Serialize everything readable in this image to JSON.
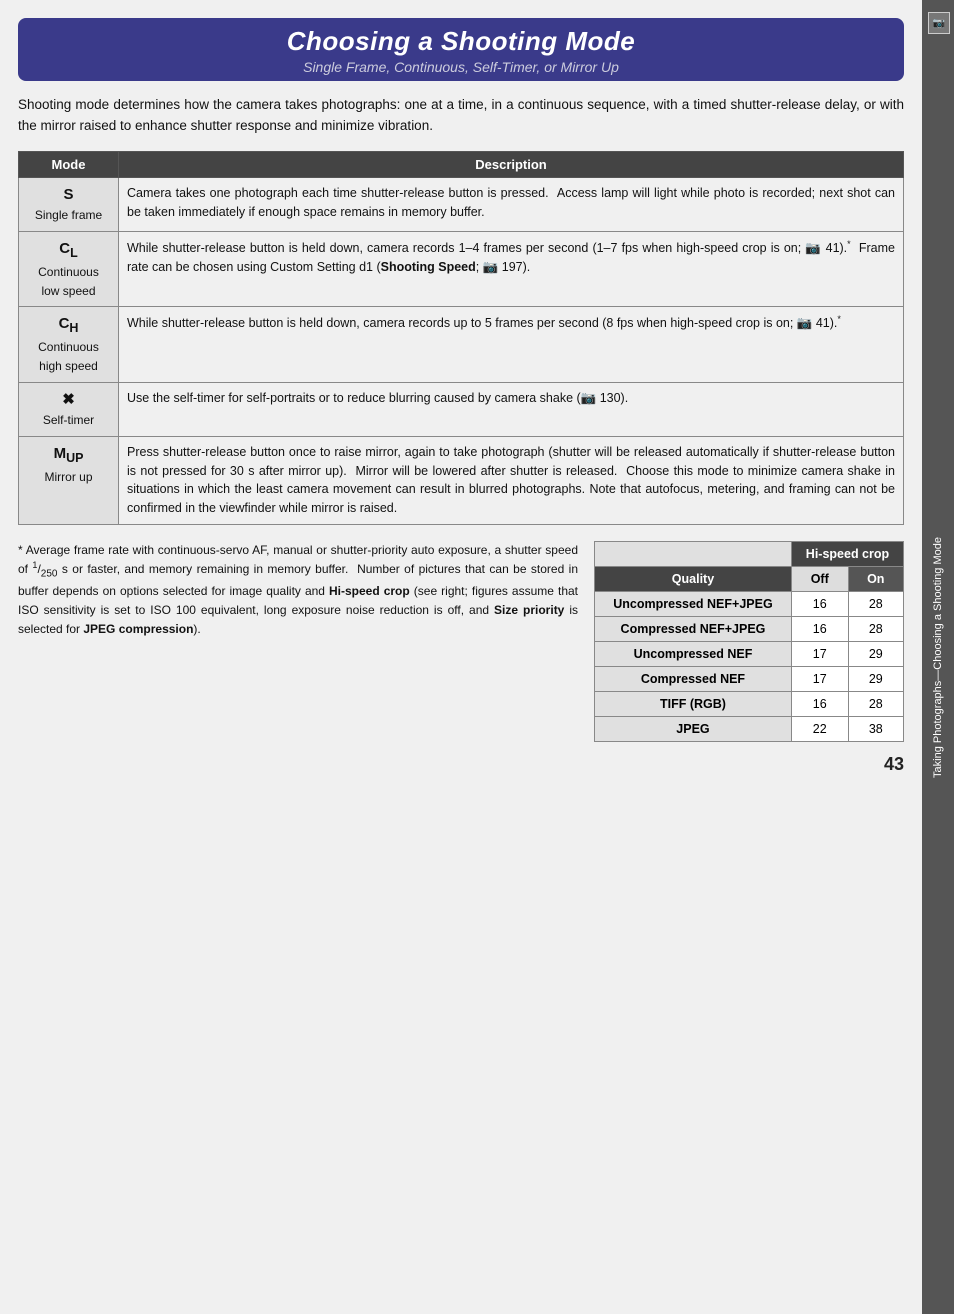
{
  "header": {
    "title": "Choosing a Shooting Mode",
    "subtitle": "Single Frame, Continuous, Self-Timer, or Mirror Up"
  },
  "intro": "Shooting mode determines how the camera takes photographs: one at a time, in a continuous sequence, with a timed shutter-release delay, or with the mirror raised to enhance shutter response and minimize vibration.",
  "table": {
    "col1": "Mode",
    "col2": "Description",
    "rows": [
      {
        "mode_symbol": "S",
        "mode_name": "Single frame",
        "description": "Camera takes one photograph each time shutter-release button is pressed.  Access lamp will light while photo is recorded; next shot can be taken immediately if enough space remains in memory buffer."
      },
      {
        "mode_symbol": "CL",
        "mode_name": "Continuous low speed",
        "description": "While shutter-release button is held down, camera records 1–4 frames per second (1–7 fps when high-speed crop is on; 📷 41).* Frame rate can be chosen using Custom Setting d1 (Shooting Speed; 📷 197)."
      },
      {
        "mode_symbol": "CH",
        "mode_name": "Continuous high speed",
        "description": "While shutter-release button is held down, camera records up to 5 frames per second (8 fps when high-speed crop is on; 📷 41).*"
      },
      {
        "mode_symbol": "Self-timer icon",
        "mode_name": "Self-timer",
        "description": "Use the self-timer for self-portraits or to reduce blurring caused by camera shake (📷 130)."
      },
      {
        "mode_symbol": "M-UP",
        "mode_name": "Mirror up",
        "description": "Press shutter-release button once to raise mirror, again to take photograph (shutter will be released automatically if shutter-release button is not pressed for 30 s after mirror up).  Mirror will be lowered after shutter is released.  Choose this mode to minimize camera shake in situations in which the least camera movement can result in blurred photographs. Note that autofocus, metering, and framing can not be confirmed in the viewfinder while mirror is raised."
      }
    ]
  },
  "footnote": {
    "asterisk": "*",
    "text": "Average frame rate with continuous-servo AF, manual or shutter-priority auto exposure, a shutter speed of 1/250 s or faster, and memory remaining in memory buffer.  Number of pictures that can be stored in buffer depends on options selected for image quality and ",
    "bold1": "Hi-speed crop",
    "text2": " (see right; figures assume that ISO sensitivity is set to ISO 100 equivalent, long exposure noise reduction is off, and ",
    "bold2": "Size priority",
    "text3": " is selected for ",
    "bold3": "JPEG compression",
    "text4": ")."
  },
  "crop_table": {
    "top_header": "Hi-speed crop",
    "quality_label": "Quality",
    "off_label": "Off",
    "on_label": "On",
    "rows": [
      {
        "label": "Uncompressed NEF+JPEG",
        "off": "16",
        "on": "28"
      },
      {
        "label": "Compressed NEF+JPEG",
        "off": "16",
        "on": "28"
      },
      {
        "label": "Uncompressed NEF",
        "off": "17",
        "on": "29"
      },
      {
        "label": "Compressed NEF",
        "off": "17",
        "on": "29"
      },
      {
        "label": "TIFF (RGB)",
        "off": "16",
        "on": "28"
      },
      {
        "label": "JPEG",
        "off": "22",
        "on": "38"
      }
    ]
  },
  "page_number": "43",
  "side_tab": {
    "label": "Taking Photographs—Choosing a Shooting Mode"
  }
}
